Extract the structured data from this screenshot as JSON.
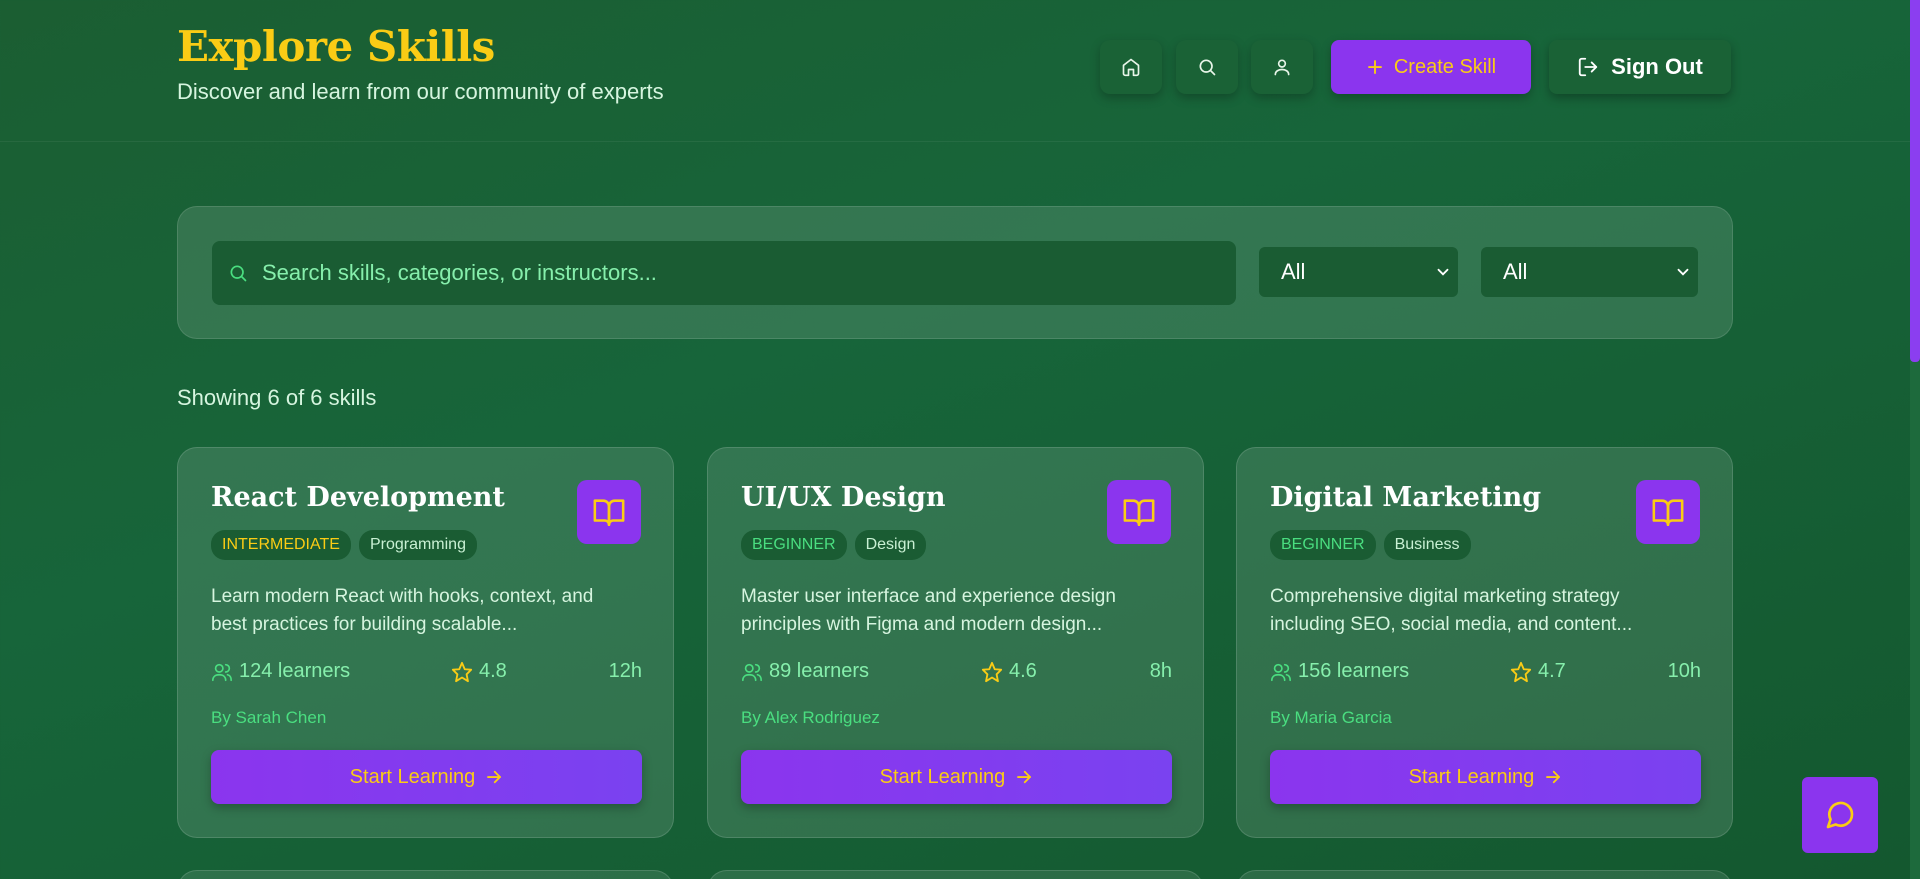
{
  "header": {
    "title": "Explore Skills",
    "subtitle": "Discover and learn from our community of experts",
    "nav": {
      "home_icon": "home-icon",
      "search_icon": "search-icon",
      "profile_icon": "user-icon"
    },
    "create_label": "Create Skill",
    "signout_label": "Sign Out"
  },
  "filters": {
    "search_placeholder": "Search skills, categories, or instructors...",
    "search_value": "",
    "level_selected": "All",
    "category_selected": "All"
  },
  "results": {
    "showing_text": "Showing 6 of 6 skills"
  },
  "skills": [
    {
      "title": "React Development",
      "level": "INTERMEDIATE",
      "category": "Programming",
      "description_line1": "Learn modern React with hooks, context, and",
      "description_line2": "best practices for building scalable...",
      "learners": "124 learners",
      "rating": "4.8",
      "duration": "12h",
      "author": "By Sarah Chen",
      "cta": "Start Learning"
    },
    {
      "title": "UI/UX Design",
      "level": "BEGINNER",
      "category": "Design",
      "description_line1": "Master user interface and experience design",
      "description_line2": "principles with Figma and modern design...",
      "learners": "89 learners",
      "rating": "4.6",
      "duration": "8h",
      "author": "By Alex Rodriguez",
      "cta": "Start Learning"
    },
    {
      "title": "Digital Marketing",
      "level": "BEGINNER",
      "category": "Business",
      "description_line1": "Comprehensive digital marketing strategy",
      "description_line2": "including SEO, social media, and content...",
      "learners": "156 learners",
      "rating": "4.7",
      "duration": "10h",
      "author": "By Maria Garcia",
      "cta": "Start Learning"
    }
  ],
  "colors": {
    "accent_purple": "#8b35ee",
    "accent_yellow": "#facc15",
    "green_text": "#4ade80",
    "bg_green": "#17653a"
  }
}
